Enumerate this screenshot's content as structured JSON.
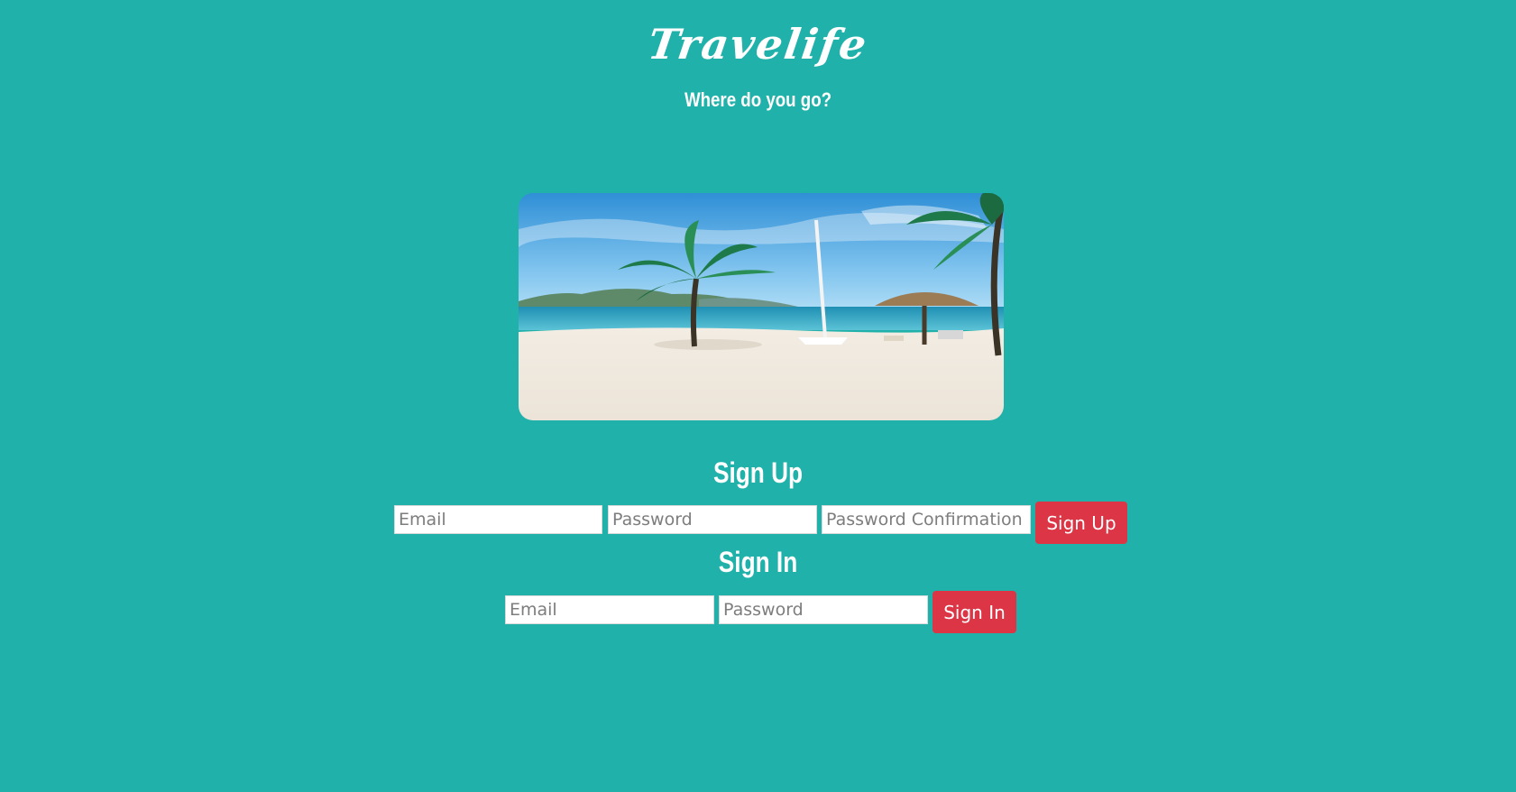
{
  "header": {
    "brand": "Travelife",
    "tagline": "Where do you go?"
  },
  "hero": {
    "image_name": "beach-with-palm-trees"
  },
  "signup": {
    "title": "Sign Up",
    "email_placeholder": "Email",
    "password_placeholder": "Password",
    "password_confirmation_placeholder": "Password Confirmation",
    "button_label": "Sign Up"
  },
  "signin": {
    "title": "Sign In",
    "email_placeholder": "Email",
    "password_placeholder": "Password",
    "button_label": "Sign In"
  },
  "colors": {
    "background": "#20b2aa",
    "button": "#dc3545",
    "text": "#ffffff"
  }
}
